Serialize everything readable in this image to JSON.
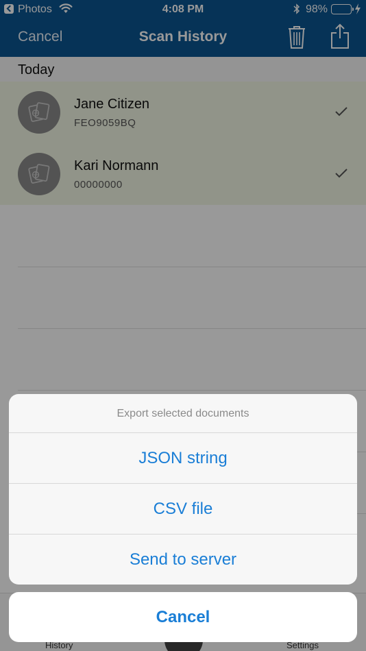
{
  "status_bar": {
    "back_app": "Photos",
    "time": "4:08 PM",
    "battery_percent": "98%",
    "battery_level": 0.98
  },
  "nav": {
    "cancel_label": "Cancel",
    "title": "Scan History"
  },
  "history": {
    "section_title": "Today",
    "items": [
      {
        "name": "Jane Citizen",
        "document_number": "FEO9059BQ",
        "selected": true
      },
      {
        "name": "Kari Normann",
        "document_number": "00000000",
        "selected": true
      }
    ]
  },
  "tab_bar": {
    "history_label": "History",
    "settings_label": "Settings"
  },
  "action_sheet": {
    "title": "Export selected documents",
    "options": [
      "JSON string",
      "CSV file",
      "Send to server"
    ],
    "cancel_label": "Cancel"
  },
  "colors": {
    "nav_bar": "#0a5591",
    "selected_row": "#f2f7e5",
    "action_blue": "#1a7ed6",
    "battery_green": "#4cd964"
  }
}
